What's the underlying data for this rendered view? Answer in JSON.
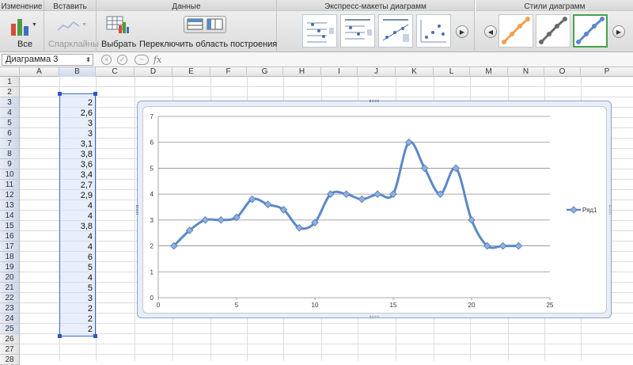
{
  "ribbon": {
    "groups": {
      "change": "Изменение",
      "insert": "Вставить",
      "data": "Данные",
      "layouts": "Экспресс-макеты диаграмм",
      "styles": "Стили диаграмм"
    },
    "all_label": "Все",
    "sparklines_label": "Спарклайны",
    "select_label": "Выбрать",
    "switch_label": "Переключить область построения"
  },
  "formula_bar": {
    "name_box": "Диаграмма 3",
    "fx": "fx",
    "formula": ""
  },
  "columns": [
    "A",
    "B",
    "C",
    "D",
    "E",
    "F",
    "G",
    "H",
    "I",
    "J",
    "K",
    "L",
    "M",
    "N",
    "O",
    "P"
  ],
  "rows": [
    "1",
    "2",
    "3",
    "4",
    "5",
    "6",
    "7",
    "8",
    "9",
    "10",
    "11",
    "12",
    "13",
    "14",
    "15",
    "16",
    "17",
    "18",
    "19",
    "20",
    "21",
    "22",
    "23",
    "24",
    "25",
    "26",
    "27",
    "28"
  ],
  "column_b_values": [
    "2",
    "2,6",
    "3",
    "3",
    "3,1",
    "3,8",
    "3,6",
    "3,4",
    "2,7",
    "2,9",
    "4",
    "4",
    "3,8",
    "4",
    "4",
    "6",
    "5",
    "4",
    "5",
    "3",
    "2",
    "2",
    "2"
  ],
  "chart_data": {
    "type": "line",
    "x": [
      1,
      2,
      3,
      4,
      5,
      6,
      7,
      8,
      9,
      10,
      11,
      12,
      13,
      14,
      15,
      16,
      17,
      18,
      19,
      20,
      21,
      22,
      23
    ],
    "series": [
      {
        "name": "Ряд1",
        "values": [
          2,
          2.6,
          3,
          3,
          3.1,
          3.8,
          3.6,
          3.4,
          2.7,
          2.9,
          4,
          4,
          3.8,
          4,
          4,
          6,
          5,
          4,
          5,
          3,
          2,
          2,
          2
        ]
      }
    ],
    "xlim": [
      0,
      25
    ],
    "ylim": [
      0,
      7
    ],
    "x_ticks": [
      "0",
      "5",
      "10",
      "15",
      "20",
      "25"
    ],
    "y_ticks": [
      "0",
      "1",
      "2",
      "3",
      "4",
      "5",
      "6",
      "7"
    ],
    "legend_position": "right",
    "grid": true,
    "smoothed": true,
    "series_color": "#5b88c8"
  }
}
